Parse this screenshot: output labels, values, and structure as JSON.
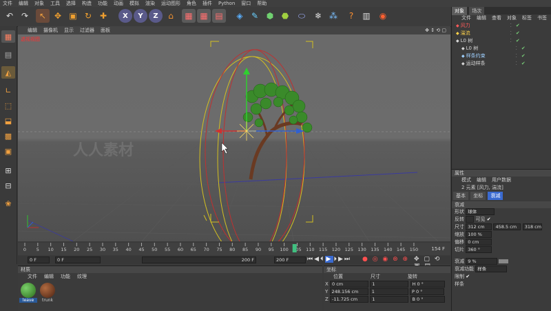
{
  "menu": [
    "文件",
    "编辑",
    "对象",
    "工具",
    "选择",
    "构造",
    "功能",
    "动画",
    "模拟",
    "渲染",
    "运动图形",
    "角色",
    "插件",
    "Python",
    "窗口",
    "帮助"
  ],
  "viewport": {
    "menu": [
      "编辑",
      "摄像机",
      "显示",
      "过滤器",
      "面板"
    ],
    "label": "透视视图"
  },
  "timeline": {
    "ticks": [
      "0",
      "5",
      "10",
      "15",
      "20",
      "25",
      "30",
      "35",
      "40",
      "45",
      "50",
      "55",
      "60",
      "65",
      "70",
      "75",
      "80",
      "85",
      "90",
      "95",
      "100",
      "105",
      "110",
      "115",
      "120",
      "125",
      "130",
      "135",
      "140",
      "145",
      "150"
    ],
    "end_label": "154 F",
    "current_frame": 104,
    "range": [
      0,
      154
    ]
  },
  "playbar": {
    "start": "0 F",
    "current": "0 F",
    "end_a": "200 F",
    "end_b": "200 F"
  },
  "materials": {
    "title": "材质",
    "menu": [
      "文件",
      "编辑",
      "功能",
      "纹理"
    ],
    "items": [
      {
        "name": "leave",
        "color": "#3a8a2a"
      },
      {
        "name": "trunk",
        "color": "#6a3a22"
      }
    ]
  },
  "coords": {
    "title": "坐标",
    "headers": [
      "位置",
      "尺寸",
      "旋转"
    ],
    "rows": [
      {
        "axis": "X",
        "pos": "0 cm",
        "size": "1",
        "rot": "H 0 °"
      },
      {
        "axis": "Y",
        "pos": "248.156 cm",
        "size": "1",
        "rot": "P 0 °"
      },
      {
        "axis": "Z",
        "pos": "-11.725 cm",
        "size": "1",
        "rot": "B 0 °"
      }
    ]
  },
  "objects": {
    "tabs": [
      "对象",
      "场次"
    ],
    "menu": [
      "文件",
      "编辑",
      "查看",
      "对象",
      "标签",
      "书签"
    ],
    "items": [
      {
        "label": "风力",
        "indent": 0,
        "color": "#ff5a5a"
      },
      {
        "label": "湍流",
        "indent": 0,
        "color": "#ffd24a"
      },
      {
        "label": "L0 树",
        "indent": 0,
        "color": "#d8d8d8"
      },
      {
        "label": "L0 树",
        "indent": 1,
        "color": "#d8d8d8"
      },
      {
        "label": "样条约束",
        "indent": 1,
        "color": "#9fd0ff"
      },
      {
        "label": "运动样条",
        "indent": 1,
        "color": "#d8d8d8"
      }
    ]
  },
  "attributes": {
    "title": "属性",
    "menu": [
      "模式",
      "编辑",
      "用户数据"
    ],
    "element": "2 元素 [风力, 湍流]",
    "tabs": [
      "基本",
      "坐标",
      "衰减"
    ],
    "section": "衰减",
    "shape_label": "形状",
    "shape_value": "球体",
    "invert_label": "反转",
    "visible_label": "可见",
    "size_label": "尺寸",
    "size_values": [
      "312 cm",
      "458.5 cm",
      "318 cm"
    ],
    "scale_label": "缩放",
    "scale_value": "100 %",
    "offset_label": "偏移",
    "offset_value": "0 cm",
    "slice_label": "切片",
    "slice_value": "360 °",
    "falloff_label": "衰减",
    "falloff_value": "9 %",
    "func_label": "衰减功能",
    "func_value": "样条",
    "limit_label": "限制",
    "spline_label": "样条"
  },
  "watermark": "人人素材"
}
